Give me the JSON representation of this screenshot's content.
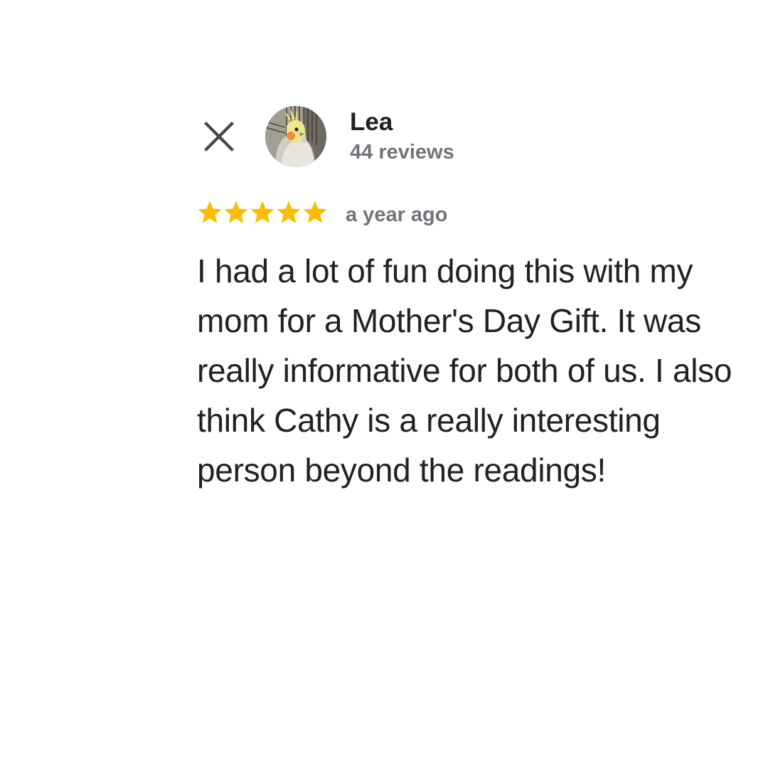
{
  "review": {
    "close_icon": "close-icon",
    "reviewer": {
      "name": "Lea",
      "review_count": "44 reviews",
      "avatar": "cockatiel-photo"
    },
    "rating": {
      "stars": 5,
      "max_stars": 5,
      "icon": "star-icon",
      "color": "#fbbc04"
    },
    "time_ago": "a year ago",
    "text": "I had a lot of fun doing this with my mom for a Mother's Day Gift. It was really informative for both of us. I also think Cathy is a really interesting person beyond the readings!"
  },
  "colors": {
    "text_primary": "#202124",
    "text_secondary": "#70757a",
    "icon": "#444746"
  }
}
